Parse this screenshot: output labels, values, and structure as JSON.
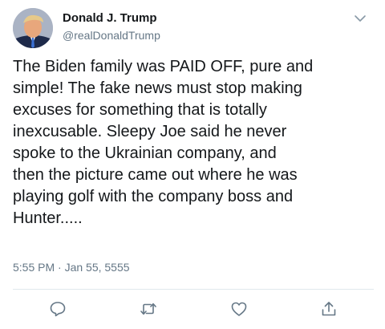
{
  "tweet": {
    "author_name": "Donald J. Trump",
    "author_handle": "@realDonaldTrump",
    "text_lines": [
      "The Biden family was PAID OFF, pure and",
      "simple! The fake news must stop making",
      "excuses for something that is totally",
      "inexcusable. Sleepy Joe said he never",
      "spoke to the Ukrainian company, and",
      "then the picture came out where he was",
      "playing golf with the company boss and",
      "Hunter....."
    ],
    "timestamp": "5:55 PM · Jan 55, 5555"
  },
  "icons": {
    "menu": "chevron-down-icon",
    "reply": "reply-icon",
    "retweet": "retweet-icon",
    "like": "like-icon",
    "share": "share-icon"
  },
  "colors": {
    "text": "#14171a",
    "secondary": "#657786",
    "icon": "#657786",
    "divider": "#e1e8ed"
  }
}
